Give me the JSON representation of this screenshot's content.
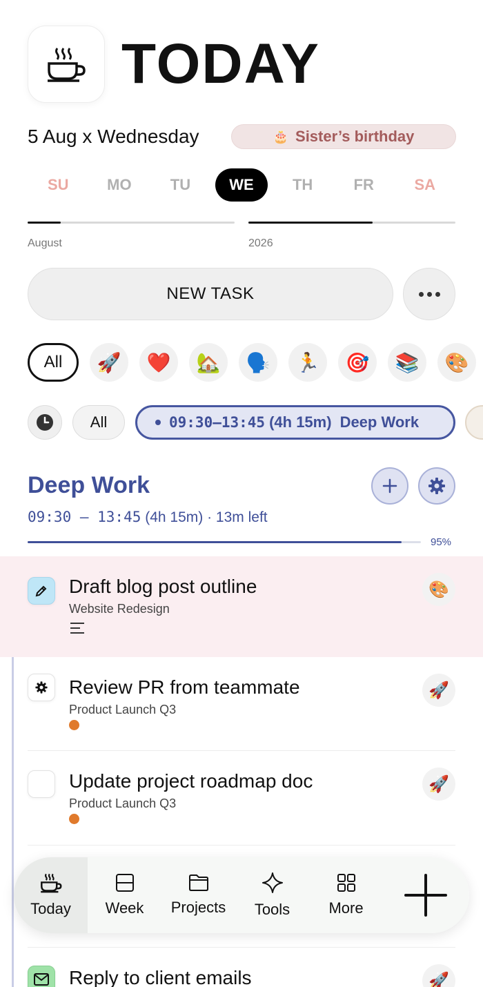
{
  "header": {
    "title": "TODAY",
    "app_icon": "coffee-cup-icon"
  },
  "date": {
    "text": "5 Aug x Wednesday",
    "event_emoji": "🎂",
    "event_label": "Sister’s birthday"
  },
  "weekdays": [
    {
      "label": "SU",
      "weekend": true
    },
    {
      "label": "MO"
    },
    {
      "label": "TU"
    },
    {
      "label": "WE",
      "active": true
    },
    {
      "label": "TH"
    },
    {
      "label": "FR"
    },
    {
      "label": "SA",
      "weekend": true
    }
  ],
  "progress": [
    {
      "label": "August",
      "fraction": 0.16
    },
    {
      "label": "2026",
      "fraction": 0.6
    }
  ],
  "actions": {
    "new_task": "NEW TASK",
    "more": "more-icon"
  },
  "categories": {
    "all_label": "All",
    "emojis": [
      "🚀",
      "❤️",
      "🏡",
      "🗣️",
      "🏃",
      "🎯",
      "📚",
      "🎨"
    ]
  },
  "time_filter": {
    "all_label": "All",
    "block_time": "09:30–13:45",
    "block_duration": "(4h 15m)",
    "block_name": "Deep Work"
  },
  "block": {
    "title": "Deep Work",
    "time_range": "09:30 — 13:45",
    "duration": "(4h 15m) · 13m left",
    "percent_label": "95%",
    "percent": 95
  },
  "tasks": [
    {
      "title": "Draft blog post outline",
      "project": "Website Redesign",
      "emoji": "🎨",
      "highlight": true,
      "status_icon": "pencil-icon"
    },
    {
      "title": "Review PR from teammate",
      "project": "Product Launch Q3",
      "emoji": "🚀",
      "status_icon": "gear-icon"
    },
    {
      "title": "Update project roadmap doc",
      "project": "Product Launch Q3",
      "emoji": "🚀",
      "status_icon": ""
    },
    {
      "title": "Reply to client emails",
      "project": "",
      "emoji": "🚀",
      "status_icon": "mail-icon"
    }
  ],
  "nav": [
    {
      "label": "Today",
      "icon": "coffee-cup-icon",
      "active": true
    },
    {
      "label": "Week",
      "icon": "calendar-week-icon"
    },
    {
      "label": "Projects",
      "icon": "folder-icon"
    },
    {
      "label": "Tools",
      "icon": "sparkle-icon"
    },
    {
      "label": "More",
      "icon": "grid-icon"
    }
  ],
  "colors": {
    "accent": "#3f4f98",
    "weekend": "#eba9a2",
    "highlight_bg": "#fbeef1",
    "dot": "#e07a2c"
  }
}
